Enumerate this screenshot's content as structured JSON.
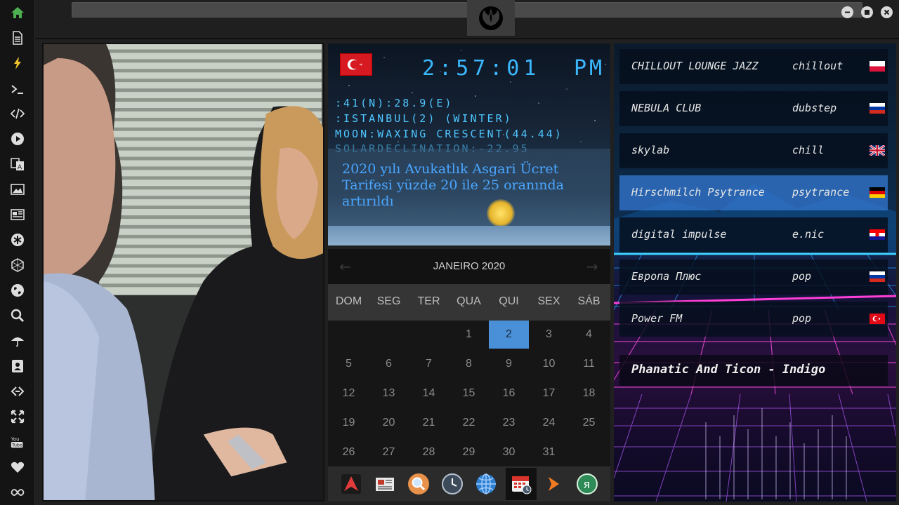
{
  "window": {
    "controls": [
      "minimize",
      "maximize",
      "close"
    ]
  },
  "sidebar": {
    "icons": [
      "home-icon",
      "document-icon",
      "lightning-icon",
      "terminal-icon",
      "code-icon",
      "play-icon",
      "translate-icon",
      "image-icon",
      "news-icon",
      "asterisk-icon",
      "hexagon-icon",
      "globe-icon",
      "search-icon",
      "umbrella-icon",
      "contact-icon",
      "link-icon",
      "expand-icon",
      "youtube-icon",
      "heart-icon",
      "infinity-icon"
    ],
    "youtube_label": "You Tube",
    "active_color": "#4caf50"
  },
  "clock": {
    "time": "2:57:01",
    "ampm": "PM",
    "coords": ":41(N):28.9(E)",
    "location": ":ISTANBUL(2) (WINTER)",
    "moon": "MOON:WAXING CRESCENT(44.44)",
    "solar": "SOLARDECLINATION:-22.95",
    "news": "2020 yılı Avukatlık Asgari Ücret Tarifesi yüzde 20 ile 25 oranında artırıldı",
    "accent": "#3bb8ff"
  },
  "calendar": {
    "title": "JANEIRO 2020",
    "prev": "←",
    "next": "→",
    "weekdays": [
      "DOM",
      "SEG",
      "TER",
      "QUA",
      "QUI",
      "SEX",
      "SÁB"
    ],
    "weeks": [
      [
        "",
        "",
        "",
        "1",
        "2",
        "3",
        "4"
      ],
      [
        "5",
        "6",
        "7",
        "8",
        "9",
        "10",
        "11"
      ],
      [
        "12",
        "13",
        "14",
        "15",
        "16",
        "17",
        "18"
      ],
      [
        "19",
        "20",
        "21",
        "22",
        "23",
        "24",
        "25"
      ],
      [
        "26",
        "27",
        "28",
        "29",
        "30",
        "31",
        ""
      ]
    ],
    "today": "2",
    "today_color": "#4a90d9"
  },
  "dock": {
    "items": [
      "arch-icon",
      "newspaper-icon",
      "magnifier-icon",
      "clock-icon",
      "globe-icon",
      "calendar-icon",
      "arrow-icon",
      "yandex-icon"
    ],
    "active": "calendar-icon"
  },
  "radio": {
    "stations": [
      {
        "name": "CHILLOUT LOUNGE JAZZ",
        "genre": "chillout",
        "flag": "poland"
      },
      {
        "name": "NEBULA CLUB",
        "genre": "dubstep",
        "flag": "russia"
      },
      {
        "name": "skylab",
        "genre": "chill",
        "flag": "uk"
      },
      {
        "name": "Hirschmilch Psytrance",
        "genre": "psytrance",
        "flag": "germany"
      },
      {
        "name": "digital impulse",
        "genre": "e.nic",
        "flag": "croatia"
      },
      {
        "name": "Европа Плюс",
        "genre": "pop",
        "flag": "russia"
      },
      {
        "name": "Power FM",
        "genre": "pop",
        "flag": "turkey"
      }
    ],
    "active_station": "Hirschmilch Psytrance",
    "now_playing": "Phanatic And Ticon - Indigo"
  }
}
